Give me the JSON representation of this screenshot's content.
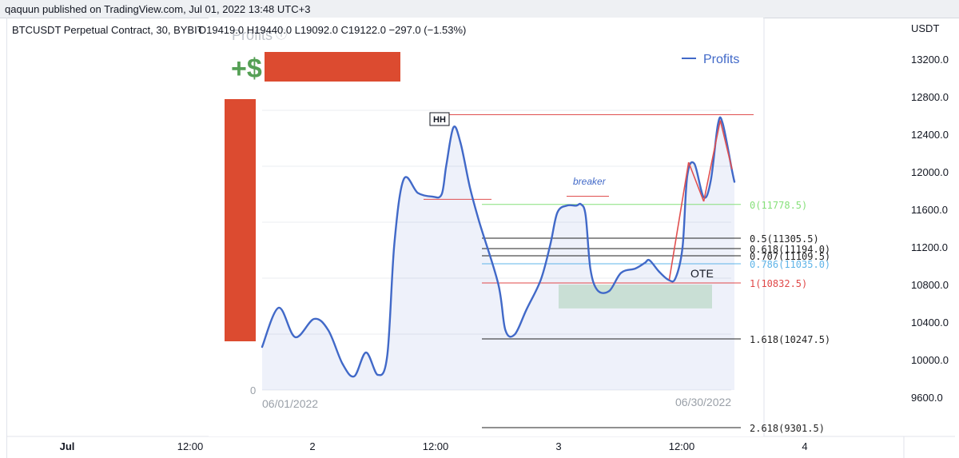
{
  "publisher_line": "qaquun published on TradingView.com, Jul 01, 2022 13:48 UTC+3",
  "symbol": {
    "title": "BTCUSDT Perpetual Contract, 30, BYBIT",
    "ohlc": "O19419.0  H19440.0  L19092.0  C19122.0  −297.0 (−1.53%)"
  },
  "price_axis": {
    "currency": "USDT",
    "ticks": [
      "13200.0",
      "12800.0",
      "12400.0",
      "12000.0",
      "11600.0",
      "11200.0",
      "10800.0",
      "10400.0",
      "10000.0",
      "9600.0"
    ]
  },
  "time_axis": {
    "ticks": [
      "Jul",
      "12:00",
      "2",
      "12:00",
      "3",
      "12:00",
      "4"
    ]
  },
  "colors": {
    "profits_line": "#4169c8",
    "redaction": "#dc4b30",
    "fib_zero": "#86e07a",
    "fib_one": "#e04848",
    "fib_786": "#5fb4e8",
    "fib_neutral": "#222222",
    "ote_zone": "#b9d7c4",
    "structure_line": "#e05050",
    "dollar": "#55a055"
  },
  "overlay": {
    "label": "Profits",
    "info_icon": "ⓘ",
    "amount_prefix": "+$",
    "legend": "Profits",
    "zero_label": "0",
    "start_date": "06/01/2022",
    "end_date": "06/30/2022"
  },
  "annotations": {
    "hh": "HH",
    "breaker": "breaker",
    "ote": "OTE"
  },
  "fib_levels": [
    {
      "label": "0(11778.5)",
      "color": "#86e07a"
    },
    {
      "label": "0.5(11305.5)",
      "color": "#222222"
    },
    {
      "label": "0.618(11194.0)",
      "color": "#222222"
    },
    {
      "label": "0.707(11109.5)",
      "color": "#222222"
    },
    {
      "label": "0.786(11035.0)",
      "color": "#5fb4e8"
    },
    {
      "label": "1(10832.5)",
      "color": "#e04848"
    },
    {
      "label": "1.618(10247.5)",
      "color": "#222222"
    },
    {
      "label": "2.618(9301.5)",
      "color": "#222222"
    }
  ],
  "chart_data": {
    "type": "line",
    "title": "Profits",
    "x": [
      "06/01/2022",
      "06/30/2022"
    ],
    "ylim": [
      9500,
      13400
    ],
    "series": [
      {
        "name": "Profits",
        "points": [
          [
            0,
            10760
          ],
          [
            0.035,
            11040
          ],
          [
            0.07,
            10830
          ],
          [
            0.11,
            10960
          ],
          [
            0.14,
            10880
          ],
          [
            0.17,
            10640
          ],
          [
            0.195,
            10550
          ],
          [
            0.22,
            10720
          ],
          [
            0.245,
            10560
          ],
          [
            0.265,
            10700
          ],
          [
            0.28,
            11500
          ],
          [
            0.3,
            11960
          ],
          [
            0.33,
            11860
          ],
          [
            0.36,
            11835
          ],
          [
            0.38,
            11850
          ],
          [
            0.39,
            12060
          ],
          [
            0.405,
            12330
          ],
          [
            0.42,
            12220
          ],
          [
            0.44,
            11900
          ],
          [
            0.46,
            11650
          ],
          [
            0.5,
            11210
          ],
          [
            0.515,
            10880
          ],
          [
            0.535,
            10850
          ],
          [
            0.56,
            11030
          ],
          [
            0.59,
            11240
          ],
          [
            0.61,
            11490
          ],
          [
            0.625,
            11720
          ],
          [
            0.645,
            11770
          ],
          [
            0.665,
            11770
          ],
          [
            0.675,
            11780
          ],
          [
            0.685,
            11700
          ],
          [
            0.695,
            11320
          ],
          [
            0.71,
            11165
          ],
          [
            0.735,
            11160
          ],
          [
            0.76,
            11290
          ],
          [
            0.79,
            11320
          ],
          [
            0.81,
            11360
          ],
          [
            0.82,
            11380
          ],
          [
            0.84,
            11300
          ],
          [
            0.86,
            11240
          ],
          [
            0.875,
            11250
          ],
          [
            0.89,
            11470
          ],
          [
            0.9,
            11980
          ],
          [
            0.915,
            12070
          ],
          [
            0.935,
            11830
          ],
          [
            0.95,
            11950
          ],
          [
            0.965,
            12350
          ],
          [
            0.975,
            12360
          ],
          [
            0.995,
            12020
          ],
          [
            1,
            11940
          ]
        ]
      }
    ],
    "structure_segments": [
      [
        [
          0.862,
          11240
        ],
        [
          0.903,
          12080
        ]
      ],
      [
        [
          0.903,
          12080
        ],
        [
          0.935,
          11800
        ]
      ],
      [
        [
          0.935,
          11800
        ],
        [
          0.97,
          12380
        ]
      ],
      [
        [
          0.97,
          12380
        ],
        [
          0.995,
          12030
        ]
      ]
    ],
    "levels": {
      "hh": 12420,
      "prior_high": 11815,
      "breaker": 11820,
      "fib": [
        11778.5,
        11305.5,
        11194.0,
        11109.5,
        11035.0,
        10832.5,
        10247.5,
        9301.5
      ],
      "ote_zone": [
        11035.0,
        11194.0
      ]
    }
  }
}
